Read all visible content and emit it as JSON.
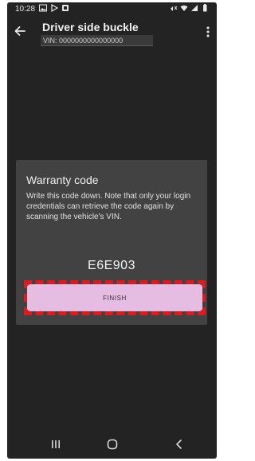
{
  "status_bar": {
    "time": "10:28",
    "left_icons": [
      "gallery-icon",
      "play-store-icon",
      "notification-icon"
    ],
    "right_icons": [
      "mute-icon",
      "wifi-icon",
      "signal-icon",
      "battery-icon"
    ]
  },
  "app_bar": {
    "title": "Driver side buckle",
    "vin": "VIN: 0000000000000000"
  },
  "dialog": {
    "title": "Warranty code",
    "body": "Write this code down. Note that only your login credentials can retrieve the code again by scanning the vehicle's VIN.",
    "code": "E6E903",
    "finish_label": "FINISH",
    "highlight_color": "#e0191f",
    "button_color": "#e5bde3"
  },
  "nav_bar": {
    "buttons": [
      "recents-icon",
      "home-icon",
      "back-icon"
    ]
  }
}
